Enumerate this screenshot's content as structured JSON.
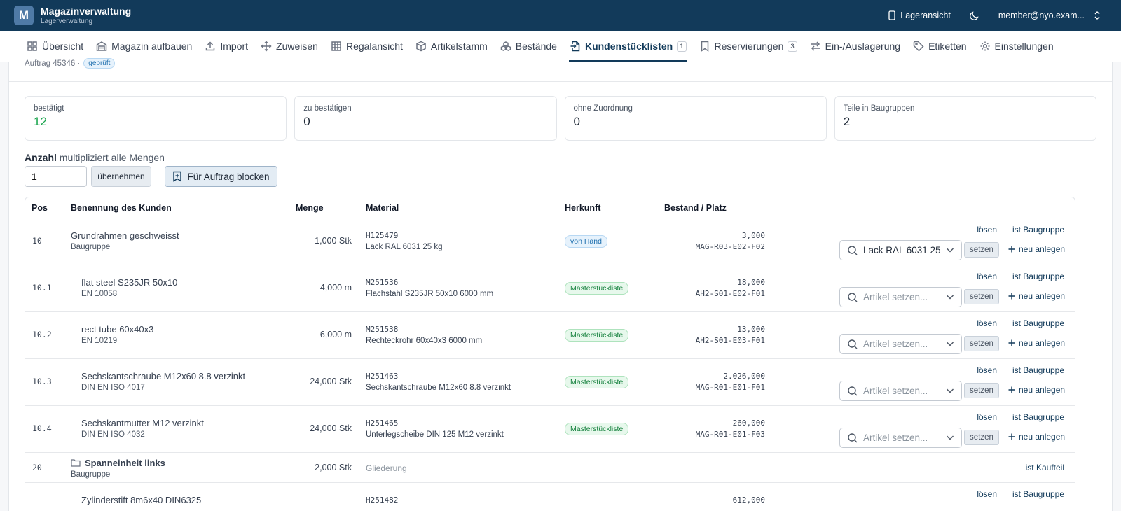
{
  "app": {
    "logo_letter": "M",
    "title": "Magazinverwaltung",
    "subtitle": "Lagerverwaltung"
  },
  "topbar": {
    "lager_label": "Lageransicht",
    "user": "member@nyo.exam..."
  },
  "nav": [
    {
      "label": "Übersicht",
      "icon": "grid-icon"
    },
    {
      "label": "Magazin aufbauen",
      "icon": "warehouse-icon"
    },
    {
      "label": "Import",
      "icon": "upload-icon"
    },
    {
      "label": "Zuweisen",
      "icon": "move-icon"
    },
    {
      "label": "Regalansicht",
      "icon": "table-icon"
    },
    {
      "label": "Artikelstamm",
      "icon": "box-icon"
    },
    {
      "label": "Bestände",
      "icon": "boxes-icon"
    },
    {
      "label": "Kundenstücklisten",
      "icon": "file-import-icon",
      "badge": "1",
      "active": true
    },
    {
      "label": "Reservierungen",
      "icon": "bookmark-icon",
      "badge": "3"
    },
    {
      "label": "Ein-/Auslagerung",
      "icon": "arrows-icon"
    },
    {
      "label": "Etiketten",
      "icon": "tag-icon"
    },
    {
      "label": "Einstellungen",
      "icon": "gear-icon"
    }
  ],
  "header": {
    "auftrag": "Auftrag 45346 ·",
    "status": "geprüft"
  },
  "stats": [
    {
      "label": "bestätigt",
      "value": "12",
      "accent": "#16a34a"
    },
    {
      "label": "zu bestätigen",
      "value": "0"
    },
    {
      "label": "ohne Zuordnung",
      "value": "0"
    },
    {
      "label": "Teile in Baugruppen",
      "value": "2"
    }
  ],
  "anzahl": {
    "label": "Anzahl",
    "hint": "multipliziert alle Mengen",
    "value": "1",
    "apply": "übernehmen",
    "block": "Für Auftrag blocken"
  },
  "columns": {
    "pos": "Pos",
    "name": "Benennung des Kunden",
    "menge": "Menge",
    "material": "Material",
    "herkunft": "Herkunft",
    "bestand": "Bestand / Platz"
  },
  "actions": {
    "loesen": "lösen",
    "baugruppe": "ist Baugruppe",
    "kaufteil": "ist Kaufteil",
    "setzen": "setzen",
    "neu": "neu anlegen",
    "placeholder": "Artikel setzen..."
  },
  "rows": [
    {
      "pos": "10",
      "name": "Grundrahmen geschweisst",
      "sub": "Baugruppe",
      "menge": "1,000 Stk",
      "code": "H125479",
      "mat": "Lack RAL 6031 25 kg",
      "herkunft": "von Hand",
      "herkunft_type": "blue",
      "bestand": "3,000",
      "platz": "MAG-R03-E02-F02",
      "select": "Lack RAL 6031 25"
    },
    {
      "pos": "10.1",
      "name": "flat steel S235JR 50x10",
      "sub": "EN 10058",
      "menge": "4,000 m",
      "code": "M251536",
      "mat": "Flachstahl S235JR 50x10 6000 mm",
      "herkunft": "Masterstückliste",
      "herkunft_type": "green",
      "bestand": "18,000",
      "platz": "AH2-S01-E02-F01",
      "indent": true
    },
    {
      "pos": "10.2",
      "name": "rect tube 60x40x3",
      "sub": "EN 10219",
      "menge": "6,000 m",
      "code": "M251538",
      "mat": "Rechteckrohr 60x40x3 6000 mm",
      "herkunft": "Masterstückliste",
      "herkunft_type": "green",
      "bestand": "13,000",
      "platz": "AH2-S01-E03-F01",
      "indent": true
    },
    {
      "pos": "10.3",
      "name": "Sechskantschraube M12x60 8.8 verzinkt",
      "sub": "DIN EN ISO 4017",
      "menge": "24,000 Stk",
      "code": "H251463",
      "mat": "Sechskantschraube M12x60 8.8 verzinkt",
      "herkunft": "Masterstückliste",
      "herkunft_type": "green",
      "bestand": "2.026,000",
      "platz": "MAG-R01-E01-F01",
      "indent": true
    },
    {
      "pos": "10.4",
      "name": "Sechskantmutter M12 verzinkt",
      "sub": "DIN EN ISO 4032",
      "menge": "24,000 Stk",
      "code": "H251465",
      "mat": "Unterlegscheibe DIN 125 M12 verzinkt",
      "herkunft": "Masterstückliste",
      "herkunft_type": "green",
      "bestand": "260,000",
      "platz": "MAG-R01-E01-F03",
      "indent": true
    },
    {
      "pos": "20",
      "name": "Spanneinheit links",
      "sub": "Baugruppe",
      "menge": "2,000 Stk",
      "mat": "Gliederung",
      "group": true
    },
    {
      "pos": "",
      "name": "Zylinderstift 8m6x40 DIN6325",
      "sub": "",
      "menge": "",
      "code": "H251482",
      "mat": "",
      "herkunft": "",
      "bestand": "612,000",
      "platz": "",
      "indent": true,
      "partial": true
    }
  ]
}
